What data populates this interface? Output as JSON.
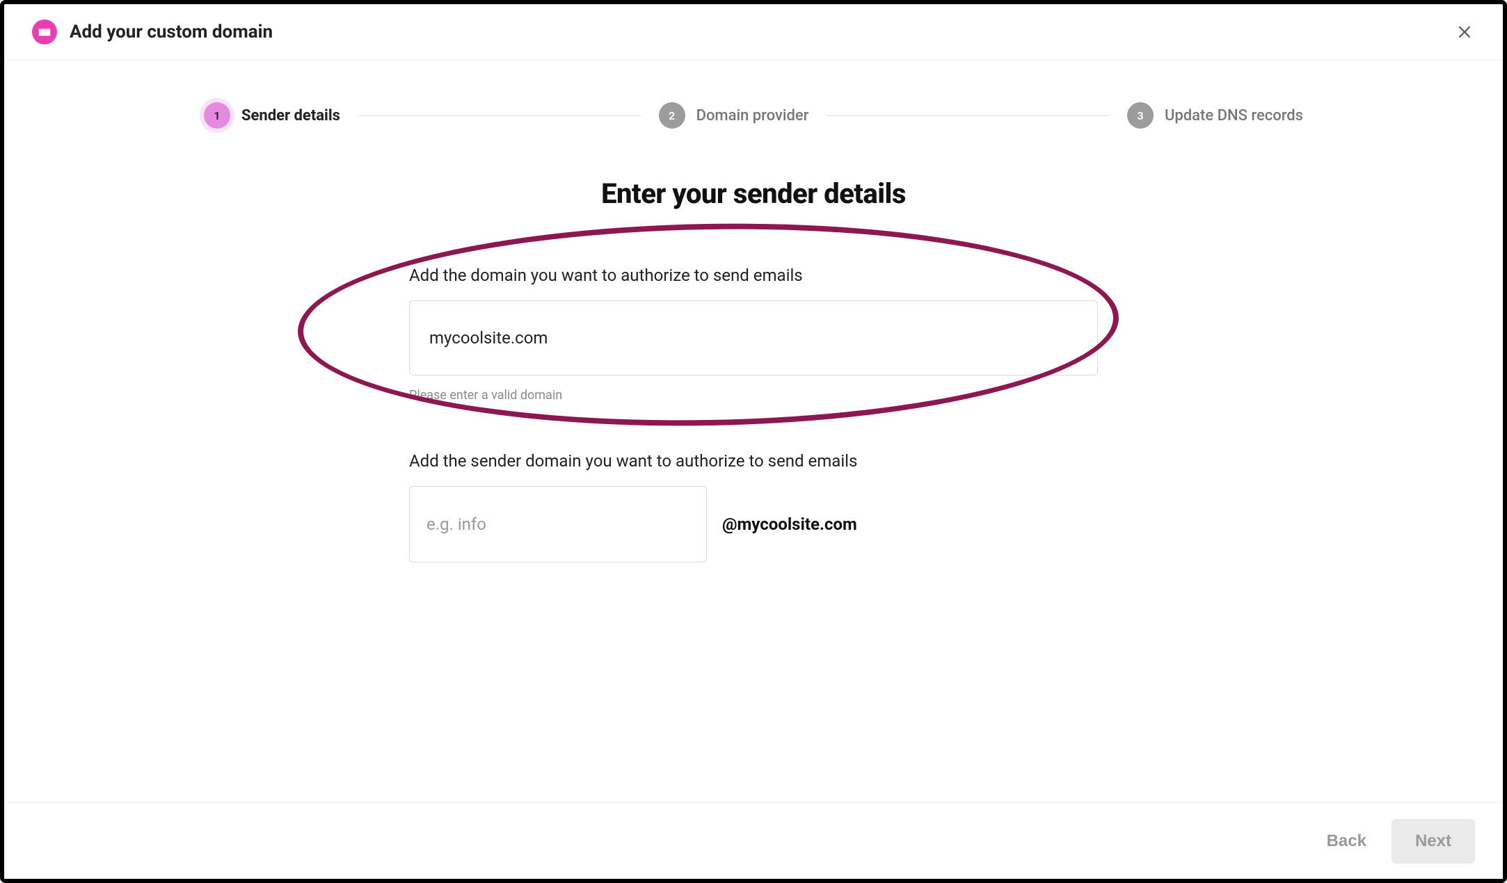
{
  "header": {
    "title": "Add your custom domain"
  },
  "stepper": {
    "step1_num": "1",
    "step1_label": "Sender details",
    "step2_num": "2",
    "step2_label": "Domain provider",
    "step3_num": "3",
    "step3_label": "Update DNS records"
  },
  "main": {
    "heading": "Enter your sender details",
    "domain_label": "Add the domain you want to authorize to send emails",
    "domain_value": "mycoolsite.com",
    "domain_help": "Please enter a valid domain",
    "sender_label": "Add the sender domain you want to authorize to send emails",
    "sender_placeholder": "e.g. info",
    "sender_suffix": "@mycoolsite.com"
  },
  "footer": {
    "back_label": "Back",
    "next_label": "Next"
  },
  "colors": {
    "accent": "#e83eb3",
    "step_active": "#e58ae0",
    "annotation": "#8d1750"
  }
}
